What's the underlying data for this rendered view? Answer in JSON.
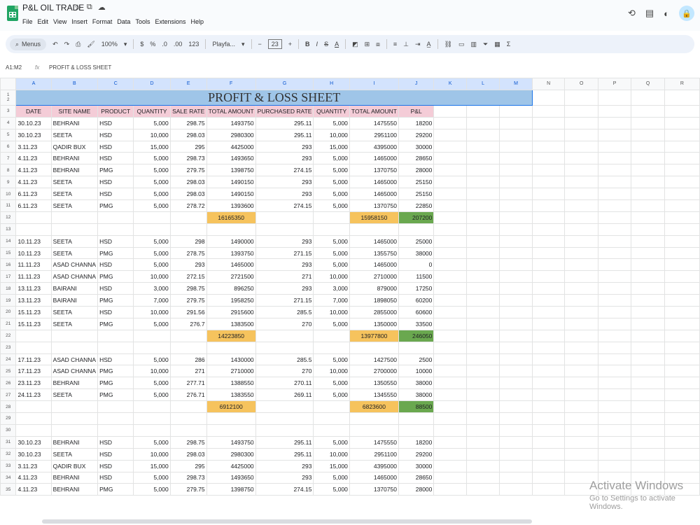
{
  "app": {
    "doc_title": "P&L OIL TRADE",
    "menus": [
      "File",
      "Edit",
      "View",
      "Insert",
      "Format",
      "Data",
      "Tools",
      "Extensions",
      "Help"
    ]
  },
  "toolbar": {
    "search_label": "Menus",
    "zoom": "100%",
    "currency": "$",
    "percent": "%",
    "decrease_decimal": ".0",
    "increase_decimal": ".00",
    "number_format": "123",
    "font": "Playfa...",
    "font_size": "23",
    "minus": "−",
    "plus": "+",
    "bold": "B",
    "italic": "I",
    "strike": "S",
    "text_color": "A"
  },
  "formula_bar": {
    "name_box": "A1:M2",
    "fx": "fx",
    "value": "PROFIT & LOSS SHEET"
  },
  "columns": [
    "A",
    "B",
    "C",
    "D",
    "E",
    "F",
    "G",
    "H",
    "I",
    "J",
    "K",
    "L",
    "M",
    "N",
    "O",
    "P",
    "Q",
    "R"
  ],
  "sheet": {
    "banner": "PROFIT & LOSS SHEET",
    "headers": [
      "DATE",
      "SITE NAME",
      "PRODUCT",
      "QUANTITY",
      "SALE RATE",
      "TOTAL AMOUNT",
      "PURCHASED RATE",
      "QUANTITY",
      "TOTAL AMOUNT",
      "P&L"
    ],
    "rows": [
      {
        "n": "4",
        "cells": [
          "30.10.23",
          "BEHRANI",
          "HSD",
          "5,000",
          "298.75",
          "1493750",
          "295.11",
          "5,000",
          "1475550",
          "18200"
        ]
      },
      {
        "n": "5",
        "cells": [
          "30.10.23",
          "SEETA",
          "HSD",
          "10,000",
          "298.03",
          "2980300",
          "295.11",
          "10,000",
          "2951100",
          "29200"
        ]
      },
      {
        "n": "6",
        "cells": [
          "3.11.23",
          "QADIR BUX",
          "HSD",
          "15,000",
          "295",
          "4425000",
          "293",
          "15,000",
          "4395000",
          "30000"
        ]
      },
      {
        "n": "7",
        "cells": [
          "4.11.23",
          "BEHRANI",
          "HSD",
          "5,000",
          "298.73",
          "1493650",
          "293",
          "5,000",
          "1465000",
          "28650"
        ]
      },
      {
        "n": "8",
        "cells": [
          "4.11.23",
          "BEHRANI",
          "PMG",
          "5,000",
          "279.75",
          "1398750",
          "274.15",
          "5,000",
          "1370750",
          "28000"
        ]
      },
      {
        "n": "9",
        "cells": [
          "4.11.23",
          "SEETA",
          "HSD",
          "5,000",
          "298.03",
          "1490150",
          "293",
          "5,000",
          "1465000",
          "25150"
        ]
      },
      {
        "n": "10",
        "cells": [
          "6.11.23",
          "SEETA",
          "HSD",
          "5,000",
          "298.03",
          "1490150",
          "293",
          "5,000",
          "1465000",
          "25150"
        ]
      },
      {
        "n": "11",
        "cells": [
          "6.11.23",
          "SEETA",
          "PMG",
          "5,000",
          "278.72",
          "1393600",
          "274.15",
          "5,000",
          "1370750",
          "22850"
        ]
      },
      {
        "n": "12",
        "type": "total",
        "cells": [
          "",
          "",
          "",
          "",
          "",
          "16165350",
          "",
          "",
          "15958150",
          "207200"
        ]
      },
      {
        "n": "13",
        "cells": [
          "",
          "",
          "",
          "",
          "",
          "",
          "",
          "",
          "",
          ""
        ]
      },
      {
        "n": "14",
        "cells": [
          "10.11.23",
          "SEETA",
          "HSD",
          "5,000",
          "298",
          "1490000",
          "293",
          "5,000",
          "1465000",
          "25000"
        ]
      },
      {
        "n": "15",
        "cells": [
          "10.11.23",
          "SEETA",
          "PMG",
          "5,000",
          "278.75",
          "1393750",
          "271.15",
          "5,000",
          "1355750",
          "38000"
        ]
      },
      {
        "n": "16",
        "cells": [
          "11.11.23",
          "ASAD CHANNA",
          "HSD",
          "5,000",
          "293",
          "1465000",
          "293",
          "5,000",
          "1465000",
          "0"
        ]
      },
      {
        "n": "17",
        "cells": [
          "11.11.23",
          "ASAD CHANNA",
          "PMG",
          "10,000",
          "272.15",
          "2721500",
          "271",
          "10,000",
          "2710000",
          "11500"
        ]
      },
      {
        "n": "18",
        "cells": [
          "13.11.23",
          "BAIRANI",
          "HSD",
          "3,000",
          "298.75",
          "896250",
          "293",
          "3,000",
          "879000",
          "17250"
        ]
      },
      {
        "n": "19",
        "cells": [
          "13.11.23",
          "BAIRANI",
          "PMG",
          "7,000",
          "279.75",
          "1958250",
          "271.15",
          "7,000",
          "1898050",
          "60200"
        ]
      },
      {
        "n": "20",
        "cells": [
          "15.11.23",
          "SEETA",
          "HSD",
          "10,000",
          "291.56",
          "2915600",
          "285.5",
          "10,000",
          "2855000",
          "60600"
        ]
      },
      {
        "n": "21",
        "cells": [
          "15.11.23",
          "SEETA",
          "PMG",
          "5,000",
          "276.7",
          "1383500",
          "270",
          "5,000",
          "1350000",
          "33500"
        ]
      },
      {
        "n": "22",
        "type": "total",
        "cells": [
          "",
          "",
          "",
          "",
          "",
          "14223850",
          "",
          "",
          "13977800",
          "246050"
        ]
      },
      {
        "n": "23",
        "cells": [
          "",
          "",
          "",
          "",
          "",
          "",
          "",
          "",
          "",
          ""
        ]
      },
      {
        "n": "24",
        "cells": [
          "17.11.23",
          "ASAD CHANNA",
          "HSD",
          "5,000",
          "286",
          "1430000",
          "285.5",
          "5,000",
          "1427500",
          "2500"
        ]
      },
      {
        "n": "25",
        "cells": [
          "17.11.23",
          "ASAD CHANNA",
          "PMG",
          "10,000",
          "271",
          "2710000",
          "270",
          "10,000",
          "2700000",
          "10000"
        ]
      },
      {
        "n": "26",
        "cells": [
          "23.11.23",
          "BEHRANI",
          "PMG",
          "5,000",
          "277.71",
          "1388550",
          "270.11",
          "5,000",
          "1350550",
          "38000"
        ]
      },
      {
        "n": "27",
        "cells": [
          "24.11.23",
          "SEETA",
          "PMG",
          "5,000",
          "276.71",
          "1383550",
          "269.11",
          "5,000",
          "1345550",
          "38000"
        ]
      },
      {
        "n": "28",
        "type": "total",
        "cells": [
          "",
          "",
          "",
          "",
          "",
          "6912100",
          "",
          "",
          "6823600",
          "88500"
        ]
      },
      {
        "n": "29",
        "cells": [
          "",
          "",
          "",
          "",
          "",
          "",
          "",
          "",
          "",
          ""
        ]
      },
      {
        "n": "30",
        "cells": [
          "",
          "",
          "",
          "",
          "",
          "",
          "",
          "",
          "",
          ""
        ]
      },
      {
        "n": "31",
        "cells": [
          "30.10.23",
          "BEHRANI",
          "HSD",
          "5,000",
          "298.75",
          "1493750",
          "295.11",
          "5,000",
          "1475550",
          "18200"
        ]
      },
      {
        "n": "32",
        "cells": [
          "30.10.23",
          "SEETA",
          "HSD",
          "10,000",
          "298.03",
          "2980300",
          "295.11",
          "10,000",
          "2951100",
          "29200"
        ]
      },
      {
        "n": "33",
        "cells": [
          "3.11.23",
          "QADIR BUX",
          "HSD",
          "15,000",
          "295",
          "4425000",
          "293",
          "15,000",
          "4395000",
          "30000"
        ]
      },
      {
        "n": "34",
        "cells": [
          "4.11.23",
          "BEHRANI",
          "HSD",
          "5,000",
          "298.73",
          "1493650",
          "293",
          "5,000",
          "1465000",
          "28650"
        ]
      },
      {
        "n": "35",
        "cells": [
          "4.11.23",
          "BEHRANI",
          "PMG",
          "5,000",
          "279.75",
          "1398750",
          "274.15",
          "5,000",
          "1370750",
          "28000"
        ]
      }
    ]
  },
  "watermark": {
    "title": "Activate Windows",
    "subtitle": "Go to Settings to activate Windows."
  }
}
